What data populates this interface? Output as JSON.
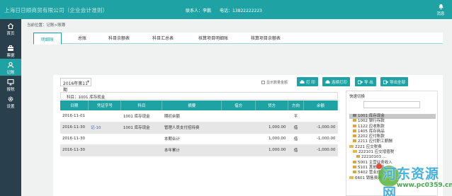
{
  "header": {
    "company": "上海日日顺商贸有限公司（企业会计准则）",
    "contact": "联系人：李鹏",
    "phone": "电话：13822222223",
    "message_label": "消息"
  },
  "sidebar": {
    "items": [
      {
        "label": "首页",
        "icon": "home-icon"
      },
      {
        "label": "票据",
        "icon": "briefcase-icon"
      },
      {
        "label": "记账",
        "icon": "user-icon"
      },
      {
        "label": "报税",
        "icon": "monitor-icon"
      },
      {
        "label": "设置",
        "icon": "gear-icon"
      }
    ],
    "active_index": 2
  },
  "breadcrumb": "当前位置：记账>账簿",
  "tabs": [
    "明细账",
    "总账",
    "科目余额表",
    "科目汇总表",
    "核算项目明细账",
    "核算项目余额表"
  ],
  "toolbar": {
    "period": "2016年第11期",
    "show_zero": "显示数量金额",
    "print": "打 印",
    "batch_print": "连续打印",
    "export": "导 出",
    "export_all": "导出全部"
  },
  "subject_label": "科目：1001 库存现金",
  "table": {
    "headers": [
      "日期",
      "凭证字号",
      "科目",
      "摘要",
      "借方",
      "贷方",
      "方向",
      "余额"
    ],
    "rows": [
      {
        "date": "2016-11-01",
        "voucher": "",
        "subject": "1001 库存现金",
        "summary": "期初余额",
        "debit": "",
        "credit": "",
        "dir": "平",
        "balance": ""
      },
      {
        "date": "2016-11-30",
        "voucher": "记-10",
        "subject": "1001 库存现金",
        "summary": "管理人员支付招待费",
        "debit": "",
        "credit": "1,000.00",
        "dir": "借",
        "balance": "-1,000.00"
      },
      {
        "date": "2016-11-30",
        "voucher": "",
        "subject": "",
        "summary": "本期合计",
        "debit": "",
        "credit": "1,000.00",
        "dir": "借",
        "balance": "-1,000.00"
      },
      {
        "date": "2016-11-30",
        "voucher": "",
        "subject": "",
        "summary": "本年累计",
        "debit": "",
        "credit": "1,000.00",
        "dir": "借",
        "balance": "-1,000.00"
      }
    ]
  },
  "quick_switch": {
    "title": "快速切换",
    "items": [
      {
        "label": "1001 库存现金",
        "type": "file",
        "indent": 1,
        "selected": true
      },
      {
        "label": "1002 银行存款",
        "type": "file",
        "indent": 1
      },
      {
        "label": "1122 应收账款",
        "type": "file",
        "indent": 1
      },
      {
        "label": "1405 库存商品",
        "type": "file",
        "indent": 1
      },
      {
        "label": "2202 应付账款",
        "type": "file",
        "indent": 1
      },
      {
        "label": "2211 应付职工薪酬",
        "type": "file",
        "indent": 1
      },
      {
        "label": "2221 应交税费",
        "type": "folder",
        "indent": 0
      },
      {
        "label": "222101 应交增值税",
        "type": "folder",
        "indent": 1
      },
      {
        "label": "22210103 ...",
        "type": "file",
        "indent": 2
      },
      {
        "label": "5001 主营业务收入",
        "type": "file",
        "indent": 1
      },
      {
        "label": "5101 其他业务",
        "type": "file",
        "indent": 1
      },
      {
        "label": "5402 营业成本",
        "type": "file",
        "indent": 1
      },
      {
        "label": "6601 销售费用",
        "type": "folder",
        "indent": 0
      }
    ]
  },
  "watermark": {
    "text": "河东资源网",
    "url": "www.pc0359.cn"
  }
}
